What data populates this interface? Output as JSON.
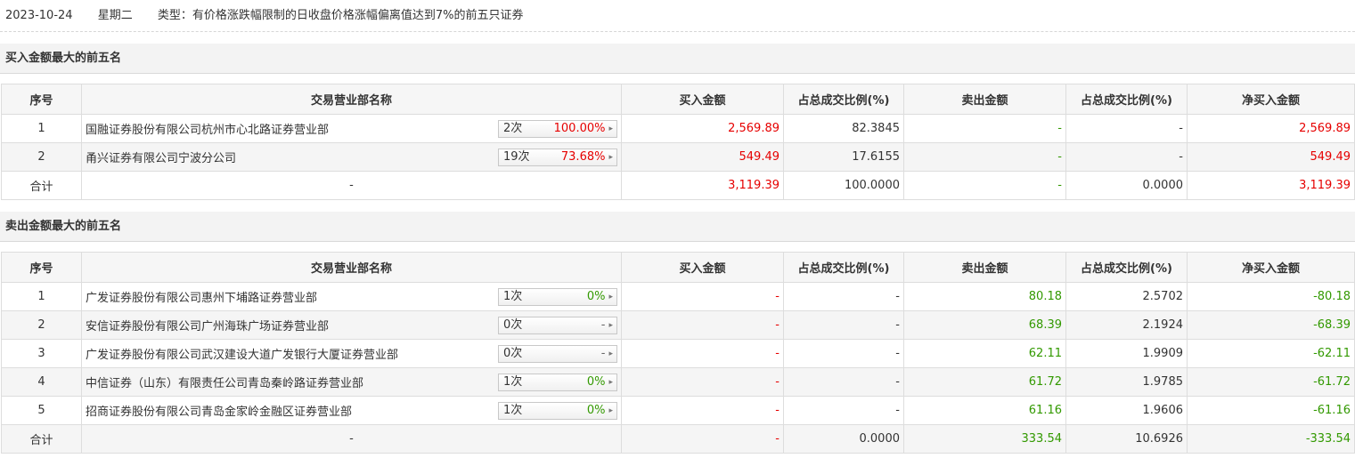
{
  "header": {
    "date": "2023-10-24",
    "weekday": "星期二",
    "type_text": "类型：有价格涨跌幅限制的日收盘价格涨幅偏离值达到7%的前五只证券"
  },
  "columns": [
    "序号",
    "交易营业部名称",
    "买入金额",
    "占总成交比例(%)",
    "卖出金额",
    "占总成交比例(%)",
    "净买入金额"
  ],
  "buy": {
    "title": "买入金额最大的前五名",
    "rows": [
      {
        "idx": "1",
        "name": "国融证券股份有限公司杭州市心北路证券营业部",
        "times": "2次",
        "pct": "100.00%",
        "pct_color": "red",
        "buy": "2,569.89",
        "buy_ratio": "82.3845",
        "sell": "-",
        "sell_ratio": "-",
        "net": "2,569.89"
      },
      {
        "idx": "2",
        "name": "甬兴证券有限公司宁波分公司",
        "times": "19次",
        "pct": "73.68%",
        "pct_color": "red",
        "buy": "549.49",
        "buy_ratio": "17.6155",
        "sell": "-",
        "sell_ratio": "-",
        "net": "549.49"
      }
    ],
    "total": {
      "label": "合计",
      "name": "-",
      "buy": "3,119.39",
      "buy_ratio": "100.0000",
      "sell": "-",
      "sell_ratio": "0.0000",
      "net": "3,119.39"
    }
  },
  "sell": {
    "title": "卖出金额最大的前五名",
    "rows": [
      {
        "idx": "1",
        "name": "广发证券股份有限公司惠州下埔路证券营业部",
        "times": "1次",
        "pct": "0%",
        "pct_color": "green",
        "buy": "-",
        "buy_ratio": "-",
        "sell": "80.18",
        "sell_ratio": "2.5702",
        "net": "-80.18"
      },
      {
        "idx": "2",
        "name": "安信证券股份有限公司广州海珠广场证券营业部",
        "times": "0次",
        "pct": "-",
        "pct_color": "grey",
        "buy": "-",
        "buy_ratio": "-",
        "sell": "68.39",
        "sell_ratio": "2.1924",
        "net": "-68.39"
      },
      {
        "idx": "3",
        "name": "广发证券股份有限公司武汉建设大道广发银行大厦证券营业部",
        "times": "0次",
        "pct": "-",
        "pct_color": "grey",
        "buy": "-",
        "buy_ratio": "-",
        "sell": "62.11",
        "sell_ratio": "1.9909",
        "net": "-62.11"
      },
      {
        "idx": "4",
        "name": "中信证券（山东）有限责任公司青岛秦岭路证券营业部",
        "times": "1次",
        "pct": "0%",
        "pct_color": "green",
        "buy": "-",
        "buy_ratio": "-",
        "sell": "61.72",
        "sell_ratio": "1.9785",
        "net": "-61.72"
      },
      {
        "idx": "5",
        "name": "招商证券股份有限公司青岛金家岭金融区证券营业部",
        "times": "1次",
        "pct": "0%",
        "pct_color": "green",
        "buy": "-",
        "buy_ratio": "-",
        "sell": "61.16",
        "sell_ratio": "1.9606",
        "net": "-61.16"
      }
    ],
    "total": {
      "label": "合计",
      "name": "-",
      "buy": "-",
      "buy_ratio": "0.0000",
      "sell": "333.54",
      "sell_ratio": "10.6926",
      "net": "-333.54"
    }
  },
  "colors": {
    "buy_red": "#e60000",
    "sell_green": "#329900",
    "header_bg": "#f6f6f6",
    "alt_row_bg": "#f5f5f5"
  },
  "icons": {
    "badge_arrow": "caret-right-icon"
  }
}
